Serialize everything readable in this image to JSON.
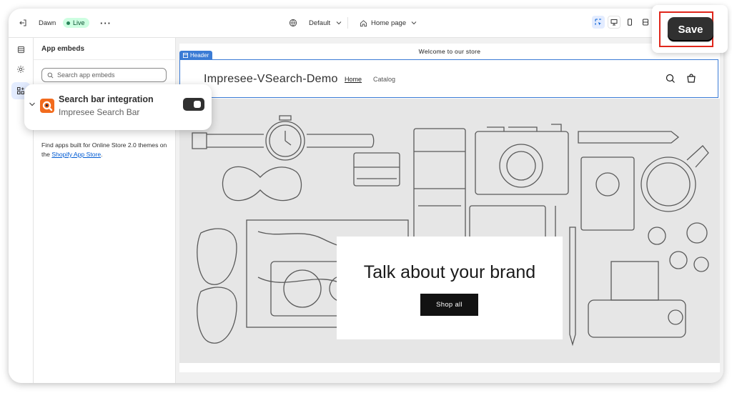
{
  "topbar": {
    "theme_name": "Dawn",
    "status_badge": "Live",
    "more_icon": "ellipsis-icon",
    "exit_icon": "exit-icon",
    "language_selector": "Default",
    "template_selector": "Home page",
    "view_icons": [
      "inspector-icon",
      "desktop-icon",
      "mobile-icon",
      "fullscreen-icon"
    ]
  },
  "save": {
    "label": "Save",
    "highlight_color": "#e0261b"
  },
  "icon_nav": [
    "sections-icon",
    "settings-icon",
    "app-embeds-icon"
  ],
  "sidebar": {
    "title": "App embeds",
    "search_placeholder": "Search app embeds",
    "find_text": "Find apps built for Online Store 2.0 themes on the",
    "find_link": "Shopify App Store",
    "find_suffix": "."
  },
  "embed_popup": {
    "title": "Search bar integration",
    "subtitle": "Impresee Search Bar",
    "enabled": true
  },
  "store": {
    "announcement": "Welcome to our store",
    "section_tag": "Header",
    "name": "Impresee-VSearch-Demo",
    "nav": [
      "Home",
      "Catalog"
    ],
    "hero_title": "Talk about your brand",
    "hero_button": "Shop all"
  }
}
